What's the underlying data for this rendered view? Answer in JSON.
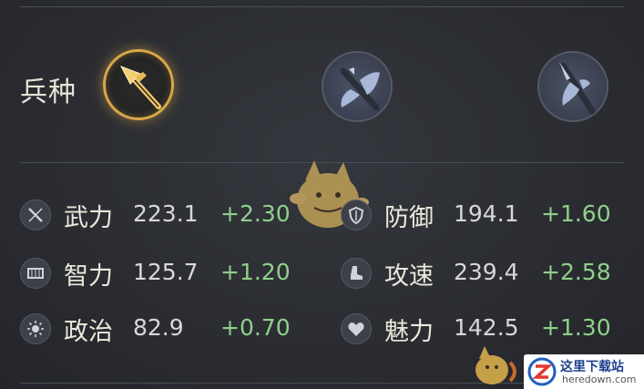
{
  "troop": {
    "label": "兵种",
    "options": [
      {
        "icon": "spear-icon",
        "selected": true
      },
      {
        "icon": "axe-icon",
        "selected": false
      },
      {
        "icon": "halberd-icon",
        "selected": false
      }
    ]
  },
  "stats": [
    {
      "icon": "sword-icon",
      "name": "武力",
      "value": "223.1",
      "bonus": "+2.30"
    },
    {
      "icon": "scroll-icon",
      "name": "智力",
      "value": "125.7",
      "bonus": "+1.20"
    },
    {
      "icon": "sun-icon",
      "name": "政治",
      "value": "82.9",
      "bonus": "+0.70"
    },
    {
      "icon": "shield-icon",
      "name": "防御",
      "value": "194.1",
      "bonus": "+1.60"
    },
    {
      "icon": "boot-icon",
      "name": "攻速",
      "value": "239.4",
      "bonus": "+2.58"
    },
    {
      "icon": "heart-icon",
      "name": "魅力",
      "value": "142.5",
      "bonus": "+1.30"
    }
  ],
  "watermark": {
    "title": "这里下载站",
    "url": "heredown.com"
  },
  "colors": {
    "accent_gold": "#d9a74a",
    "bonus_green": "#8fd08a"
  }
}
